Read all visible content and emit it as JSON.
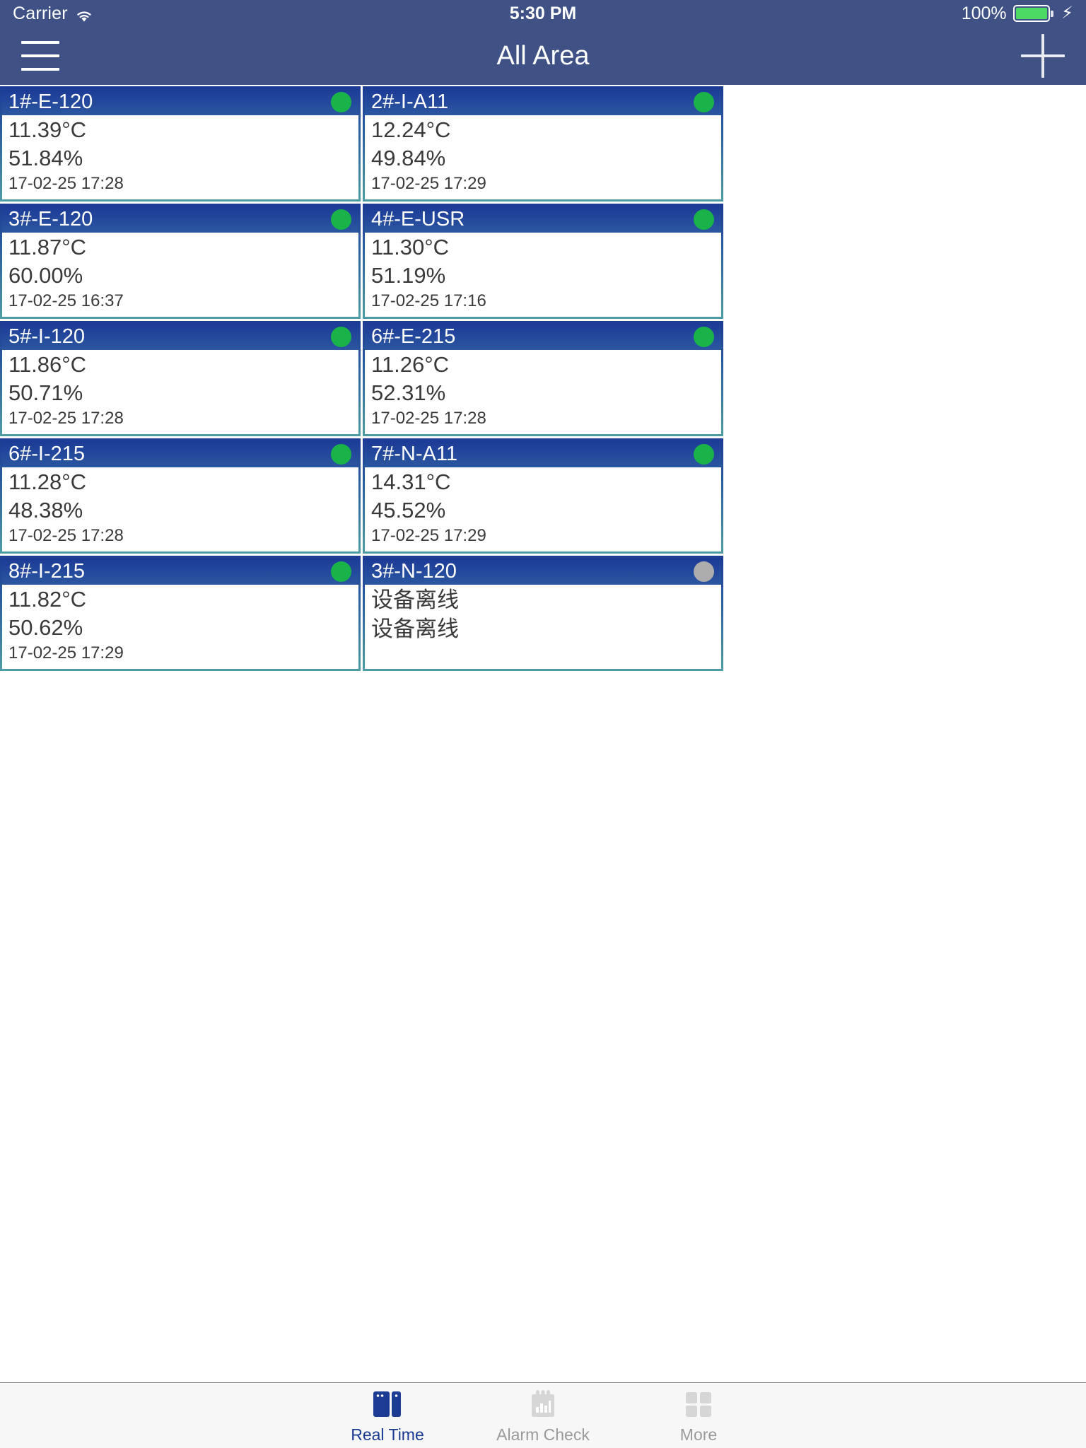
{
  "status_bar": {
    "carrier": "Carrier",
    "wifi_icon": "wifi-icon",
    "time": "5:30 PM",
    "battery_percent": "100%",
    "battery_level": 100,
    "charging": true
  },
  "nav_bar": {
    "menu_icon": "hamburger-menu-icon",
    "title": "All Area",
    "add_icon": "plus-icon"
  },
  "colors": {
    "nav_background": "#3f5185",
    "card_header_blue": "#1f3f99",
    "card_border_teal": "#4e9ba5",
    "status_online": "#19b34a",
    "status_offline": "#adadad",
    "tab_active": "#1b3c92",
    "tab_inactive": "#9a9a9a",
    "battery_green": "#4cd964"
  },
  "cards": [
    {
      "title": "1#-E-120",
      "temperature": "11.39°C",
      "humidity": "51.84%",
      "timestamp": "17-02-25 17:28",
      "status": "online"
    },
    {
      "title": "2#-I-A11",
      "temperature": "12.24°C",
      "humidity": "49.84%",
      "timestamp": "17-02-25 17:29",
      "status": "online"
    },
    {
      "title": "3#-E-120",
      "temperature": "11.87°C",
      "humidity": "60.00%",
      "timestamp": "17-02-25 16:37",
      "status": "online"
    },
    {
      "title": "4#-E-USR",
      "temperature": "11.30°C",
      "humidity": "51.19%",
      "timestamp": "17-02-25 17:16",
      "status": "online"
    },
    {
      "title": "5#-I-120",
      "temperature": "11.86°C",
      "humidity": "50.71%",
      "timestamp": "17-02-25 17:28",
      "status": "online"
    },
    {
      "title": "6#-E-215",
      "temperature": "11.26°C",
      "humidity": "52.31%",
      "timestamp": "17-02-25 17:28",
      "status": "online"
    },
    {
      "title": "6#-I-215",
      "temperature": "11.28°C",
      "humidity": "48.38%",
      "timestamp": "17-02-25 17:28",
      "status": "online"
    },
    {
      "title": "7#-N-A11",
      "temperature": "14.31°C",
      "humidity": "45.52%",
      "timestamp": "17-02-25 17:29",
      "status": "online"
    },
    {
      "title": "8#-I-215",
      "temperature": "11.82°C",
      "humidity": "50.62%",
      "timestamp": "17-02-25 17:29",
      "status": "online"
    },
    {
      "title": "3#-N-120",
      "temperature": "设备离线",
      "humidity": "设备离线",
      "timestamp": "",
      "status": "offline"
    }
  ],
  "tab_bar": {
    "tabs": [
      {
        "label": "Real Time",
        "icon": "realtime-panels-icon",
        "active": true
      },
      {
        "label": "Alarm Check",
        "icon": "alarm-chart-icon",
        "active": false
      },
      {
        "label": "More",
        "icon": "more-grid-icon",
        "active": false
      }
    ]
  }
}
